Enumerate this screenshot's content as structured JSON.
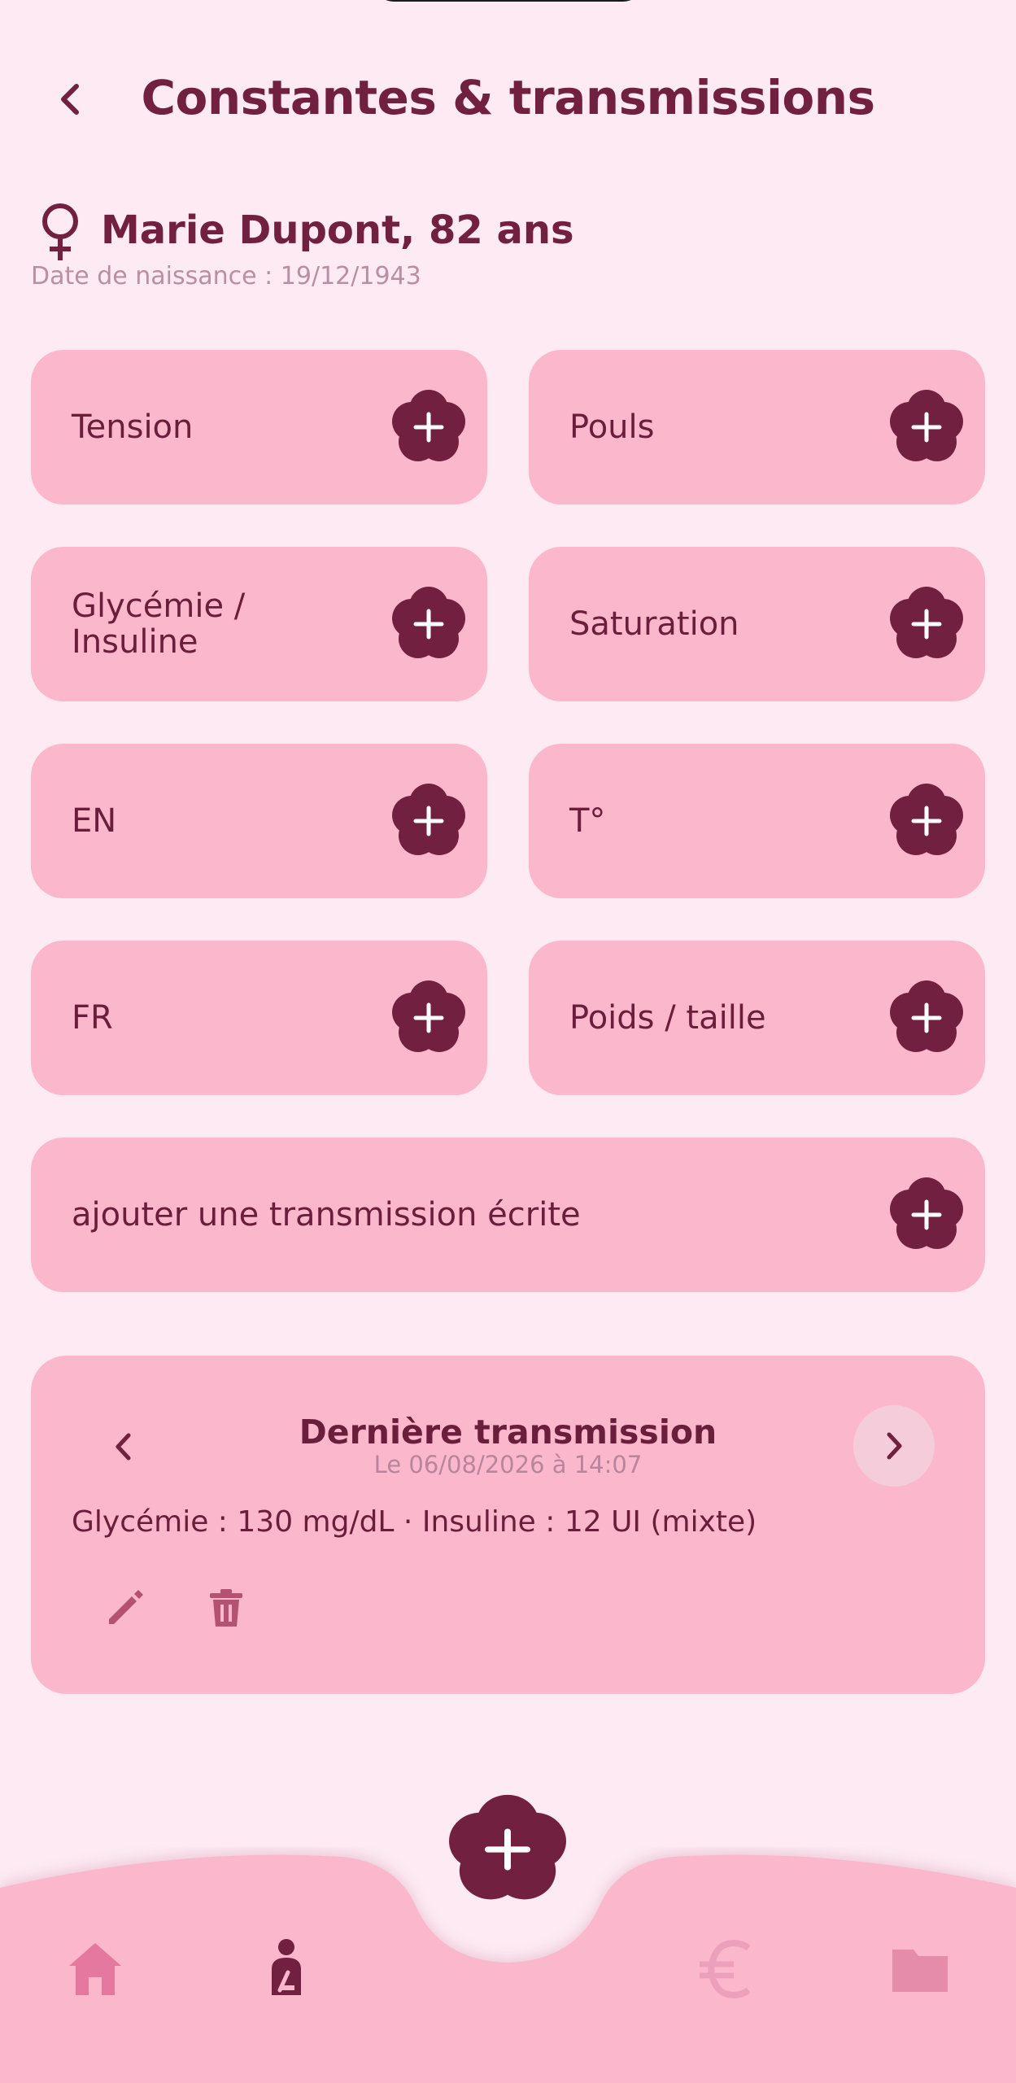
{
  "header": {
    "title": "Constantes & transmissions"
  },
  "patient": {
    "name": "Marie Dupont, 82 ans",
    "birth_date": "Date de naissance : 19/12/1943",
    "gender_icon": "female-symbol-icon"
  },
  "measures": [
    {
      "label": "Tension"
    },
    {
      "label": "Pouls"
    },
    {
      "label": "Glycémie /\nInsuline"
    },
    {
      "label": "Saturation"
    },
    {
      "label": "EN"
    },
    {
      "label": "T°"
    },
    {
      "label": "FR"
    },
    {
      "label": "Poids / taille"
    }
  ],
  "written_transmission": {
    "label": "ajouter une transmission écrite"
  },
  "last_transmission": {
    "title": "Dernière transmission",
    "date": "Le 06/08/2026 à 14:07",
    "content": "Glycémie : 130 mg/dL · Insuline : 12 UI (mixte)"
  },
  "nav": {
    "items": [
      "home-icon",
      "patient-icon",
      "euro-icon",
      "folder-icon"
    ],
    "active": "patient-icon"
  },
  "colors": {
    "background": "#FDEAF2",
    "card": "#FBB7CC",
    "accent": "#72203F",
    "muted": "#B98FA3"
  }
}
